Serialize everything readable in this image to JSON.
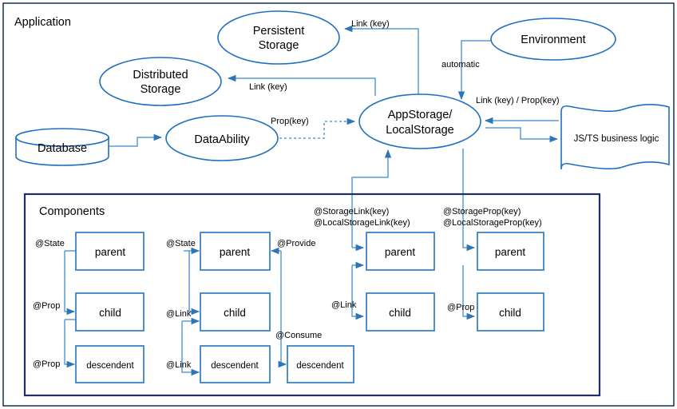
{
  "frames": {
    "application_label": "Application",
    "components_label": "Components",
    "outer_border_color": "#1F3C68",
    "inner_border_color": "#1F2E63"
  },
  "palette": {
    "shape_stroke": "#1F6FC0",
    "box_stroke": "#2E7CC4",
    "connector": "#5B9BD5",
    "arrowhead": "#2E75B6",
    "text": "#000000"
  },
  "nodes": {
    "persistent_storage": {
      "line1": "Persistent",
      "line2": "Storage"
    },
    "distributed_storage": {
      "line1": "Distributed",
      "line2": "Storage"
    },
    "environment": {
      "label": "Environment"
    },
    "database": {
      "label": "Database"
    },
    "data_ability": {
      "label": "DataAbility"
    },
    "app_storage": {
      "line1": "AppStorage/",
      "line2": "LocalStorage"
    },
    "business_logic": {
      "label": "JS/TS business logic"
    }
  },
  "edge_labels": {
    "persistent_link": "Link (key)",
    "distributed_link": "Link (key)",
    "environment_automatic": "automatic",
    "business_link_prop": "Link (key) / Prop(key)",
    "data_ability_prop": "Prop(key)",
    "storage_link_line1": "@StorageLink(key)",
    "storage_link_line2": "@LocalStorageLink(key)",
    "storage_prop_line1": "@StorageProp(key)",
    "storage_prop_line2": "@LocalStorageProp(key)"
  },
  "components": {
    "column1": {
      "boxes": [
        {
          "label": "parent",
          "size": "normal"
        },
        {
          "label": "child",
          "size": "normal"
        },
        {
          "label": "descendent",
          "size": "small"
        }
      ],
      "decorators": [
        "@State",
        "@Prop",
        "@Prop"
      ]
    },
    "column2": {
      "boxes": [
        {
          "label": "parent",
          "size": "normal"
        },
        {
          "label": "child",
          "size": "normal"
        },
        {
          "label": "descendent",
          "size": "small"
        }
      ],
      "decorators": [
        "@State",
        "@Link",
        "@Link"
      ],
      "provide_label": "@Provide",
      "consume_label": "@Consume",
      "consume_box": {
        "label": "descendent",
        "size": "small"
      }
    },
    "column3": {
      "boxes": [
        {
          "label": "parent",
          "size": "normal"
        },
        {
          "label": "child",
          "size": "normal"
        }
      ],
      "decorators": [
        "@Link"
      ]
    },
    "column4": {
      "boxes": [
        {
          "label": "parent",
          "size": "normal"
        },
        {
          "label": "child",
          "size": "normal"
        }
      ],
      "decorators": [
        "@Prop"
      ]
    }
  }
}
